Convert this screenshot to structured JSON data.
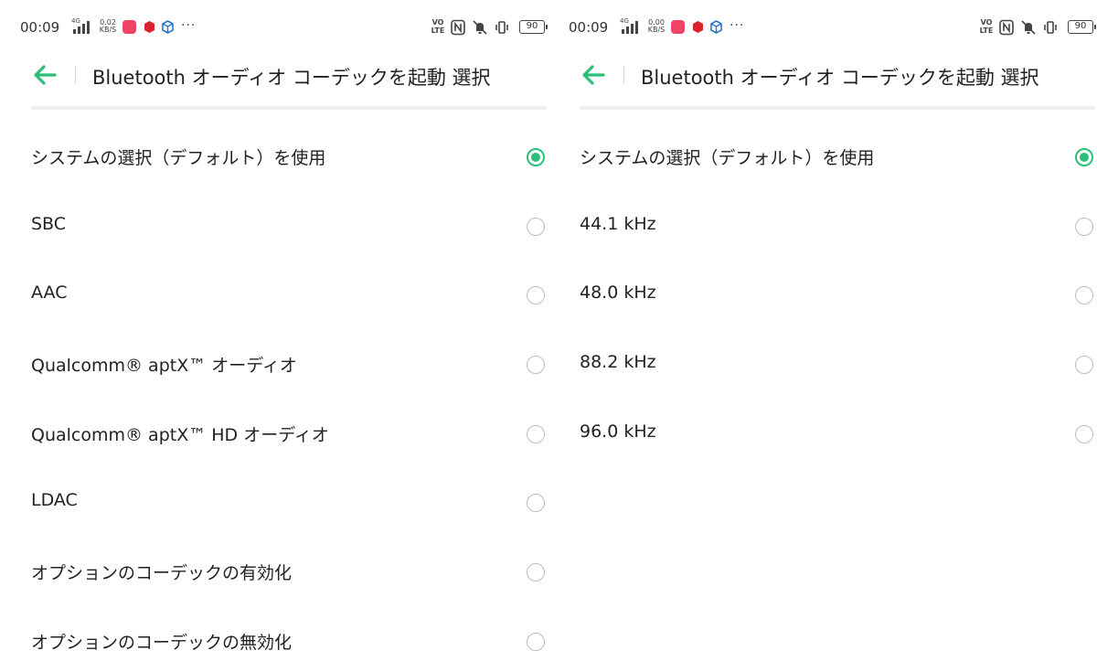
{
  "accent_color": "#2bbf78",
  "screens": [
    {
      "status_bar": {
        "time": "00:09",
        "network": "4G",
        "speed_value": "0.02",
        "speed_unit": "KB/S",
        "volte_top": "VO",
        "volte_bottom": "LTE",
        "battery": "90",
        "icons": [
          "app-notification-icon",
          "app-notification-icon",
          "app-notification-icon",
          "more-notifications-icon",
          "nfc-icon",
          "vibrate-mute-icon",
          "vibrate-icon"
        ]
      },
      "title": "Bluetooth オーディオ コーデックを起動 選択",
      "options": [
        {
          "label": "システムの選択（デフォルト）を使用",
          "selected": true
        },
        {
          "label": "SBC",
          "selected": false
        },
        {
          "label": "AAC",
          "selected": false
        },
        {
          "label": "Qualcomm® aptX™ オーディオ",
          "selected": false
        },
        {
          "label": "Qualcomm® aptX™ HD オーディオ",
          "selected": false
        },
        {
          "label": "LDAC",
          "selected": false
        },
        {
          "label": "オプションのコーデックの有効化",
          "selected": false
        },
        {
          "label": "オプションのコーデックの無効化",
          "selected": false
        }
      ]
    },
    {
      "status_bar": {
        "time": "00:09",
        "network": "4G",
        "speed_value": "0.00",
        "speed_unit": "KB/S",
        "volte_top": "VO",
        "volte_bottom": "LTE",
        "battery": "90",
        "icons": [
          "app-notification-icon",
          "app-notification-icon",
          "app-notification-icon",
          "more-notifications-icon",
          "nfc-icon",
          "vibrate-mute-icon",
          "vibrate-icon"
        ]
      },
      "title": "Bluetooth オーディオ コーデックを起動 選択",
      "options": [
        {
          "label": "システムの選択（デフォルト）を使用",
          "selected": true
        },
        {
          "label": "44.1 kHz",
          "selected": false
        },
        {
          "label": "48.0 kHz",
          "selected": false
        },
        {
          "label": "88.2 kHz",
          "selected": false
        },
        {
          "label": "96.0 kHz",
          "selected": false
        }
      ]
    }
  ]
}
